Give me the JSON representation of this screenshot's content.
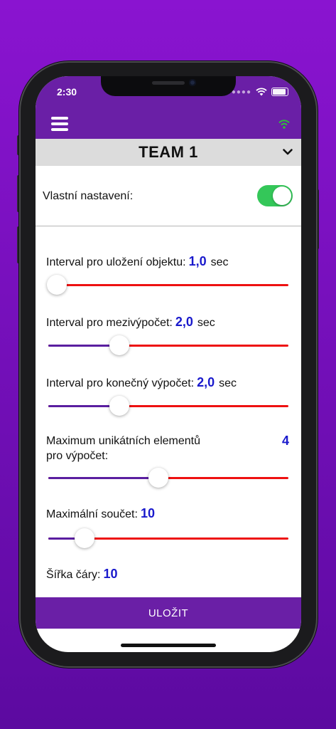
{
  "status": {
    "time": "2:30"
  },
  "header": {
    "team": "TEAM 1"
  },
  "custom": {
    "label": "Vlastní nastavení:",
    "enabled": true
  },
  "settings": [
    {
      "label": "Interval pro uložení objektu:",
      "value": "1,0",
      "unit": "sec",
      "fraction": 0.0
    },
    {
      "label": "Interval pro mezivýpočet:",
      "value": "2,0",
      "unit": "sec",
      "fraction": 0.27
    },
    {
      "label": "Interval pro konečný výpočet:",
      "value": "2,0",
      "unit": "sec",
      "fraction": 0.27
    },
    {
      "label_line1": "Maximum unikátních elementů",
      "label_line2": "pro výpočet:",
      "value": "4",
      "fraction": 0.44
    },
    {
      "label": "Maximální součet:",
      "value": "10",
      "fraction": 0.12
    },
    {
      "label": "Šířka čáry:",
      "value": "10"
    }
  ],
  "footer": {
    "save_label": "ULOŽIT"
  },
  "colors": {
    "accent": "#6a1fa6",
    "value_blue": "#1919cc",
    "track_red": "#ee1111",
    "toggle_green": "#34c759"
  },
  "icons": {
    "menu": "hamburger-icon",
    "signal": "wifi-icon",
    "dropdown": "chevron-down-icon"
  }
}
